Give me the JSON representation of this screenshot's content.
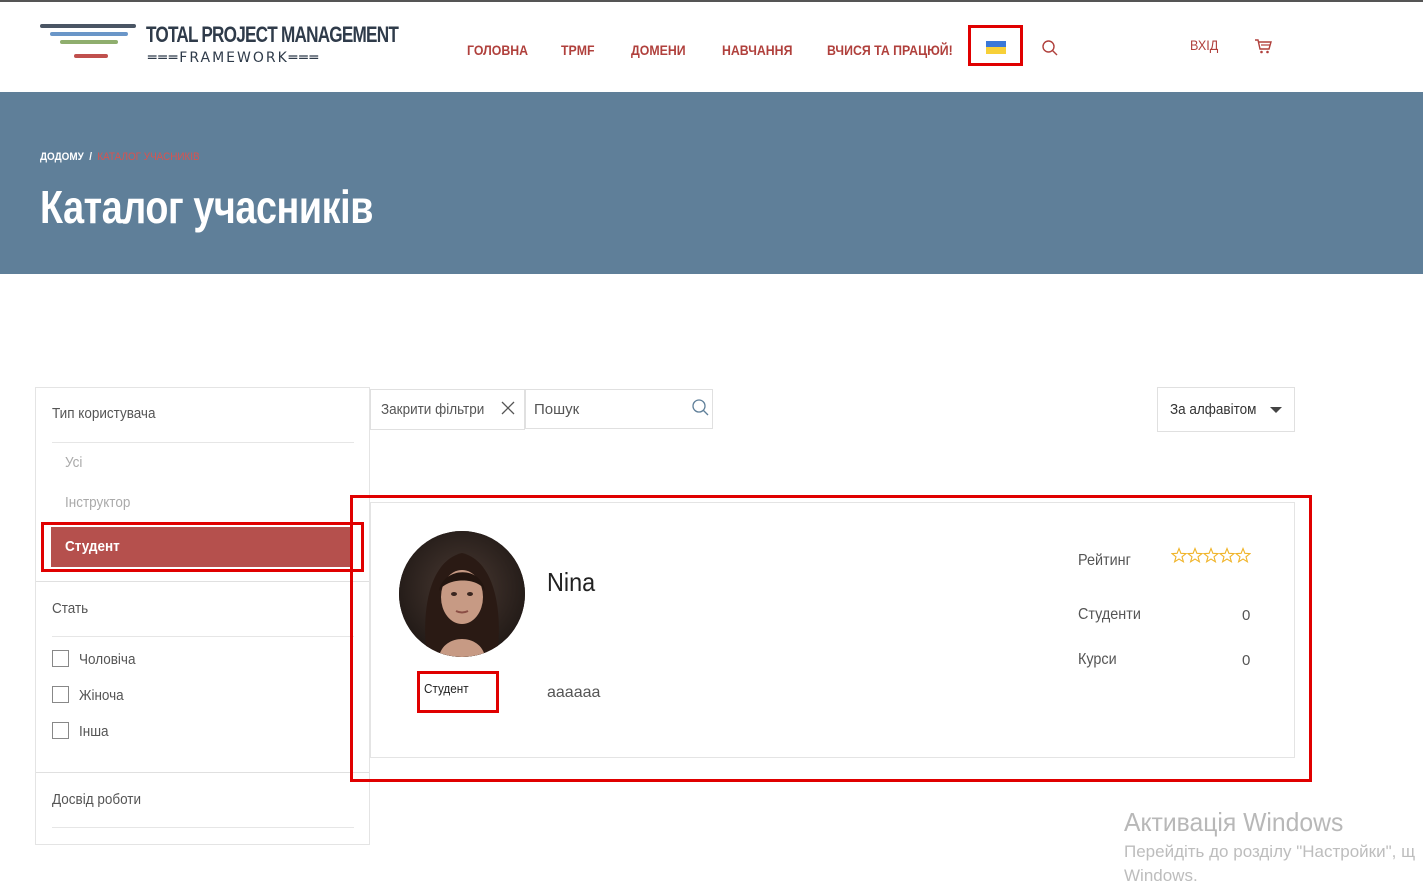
{
  "brand": {
    "title": "TOTAL PROJECT MANAGEMENT",
    "subtitle": "═══FRAMEWORK═══",
    "line_colors": [
      "#4a5564",
      "#6a96c8",
      "#8fae6e",
      "#c0504d"
    ]
  },
  "nav": {
    "items": [
      "ГОЛОВНА",
      "TPMF",
      "ДОМЕНИ",
      "НАВЧАННЯ",
      "ВЧИСЯ ТА ПРАЦЮЙ!"
    ],
    "login": "ВХІД"
  },
  "breadcrumb": {
    "home": "ДОДОМУ",
    "separator": "/",
    "current": "КАТАЛОГ УЧАСНИКІВ"
  },
  "page": {
    "title": "Каталог учасників"
  },
  "filters": {
    "user_type": {
      "title": "Тип користувача",
      "options": [
        "Усі",
        "Інструктор",
        "Студент"
      ],
      "selected": "Студент"
    },
    "gender": {
      "title": "Стать",
      "options": [
        "Чоловіча",
        "Жіноча",
        "Інша"
      ]
    },
    "experience": {
      "title": "Досвід роботи"
    }
  },
  "toolbar": {
    "close_filters": "Закрити фільтри",
    "search_placeholder": "Пошук",
    "sort_selected": "За алфавітом"
  },
  "member": {
    "name": "Nina",
    "role": "Студент",
    "bio": "aaaaaa",
    "rating_label": "Рейтинг",
    "rating_stars_filled": 0,
    "rating_stars_total": 5,
    "students_label": "Студенти",
    "students_value": "0",
    "courses_label": "Курси",
    "courses_value": "0"
  },
  "watermark": {
    "title": "Активація Windows",
    "line1": "Перейдіть до розділу \"Настройки\", щ",
    "line2": "Windows."
  },
  "colors": {
    "accent": "#b0403c",
    "banner": "#5f7f99",
    "active_filter": "#b5504d",
    "highlight": "#e00000",
    "star": "#f0b429"
  }
}
